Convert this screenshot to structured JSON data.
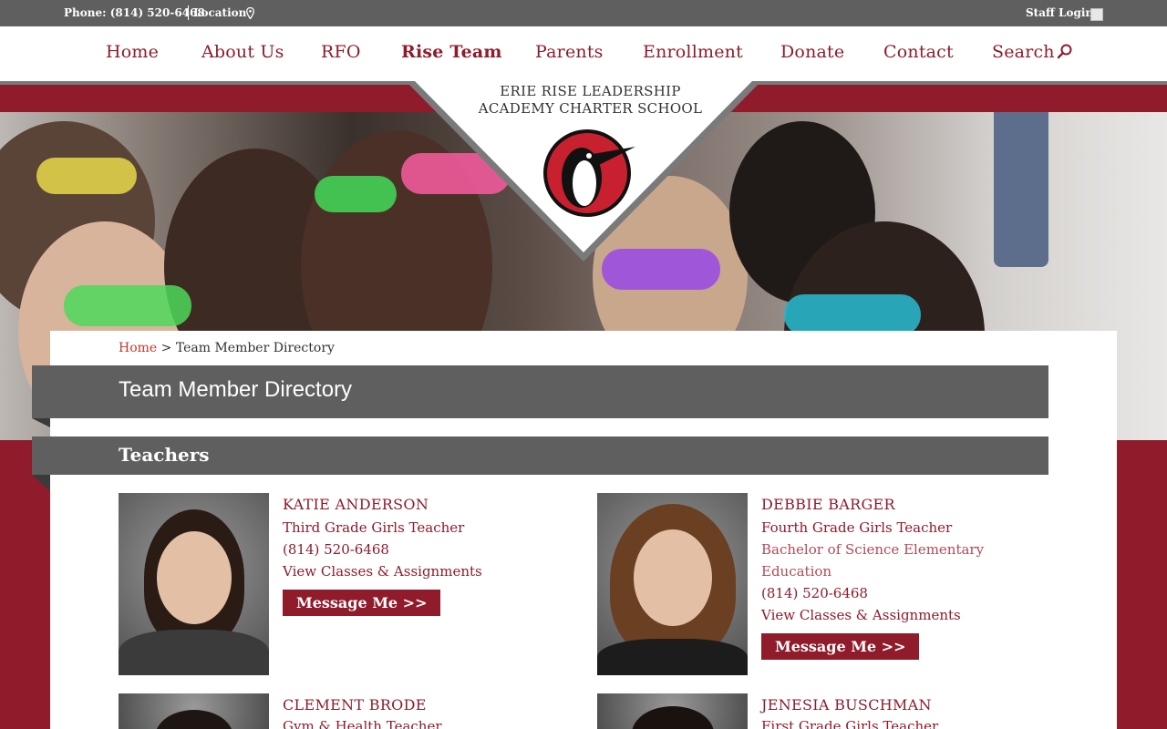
{
  "topbar": {
    "phone": "Phone: (814) 520-6468",
    "location": "Location",
    "staff_login": "Staff Login"
  },
  "nav": {
    "items": [
      "Home",
      "About Us",
      "RFO",
      "Rise Team",
      "Parents",
      "Enrollment",
      "Donate",
      "Contact",
      "Search"
    ],
    "active": "Rise Team"
  },
  "logo": {
    "line1": "ERIE RISE LEADERSHIP",
    "line2": "ACADEMY CHARTER SCHOOL"
  },
  "breadcrumb": {
    "home": "Home",
    "separator": ">",
    "current": "Team Member Directory"
  },
  "page_title": "Team Member Directory",
  "section_title": "Teachers",
  "teachers": [
    {
      "name": "KATIE ANDERSON",
      "role": "Third Grade Girls Teacher",
      "phone": "(814) 520-6468",
      "classes_link": "View Classes & Assignments",
      "button": "Message Me >>"
    },
    {
      "name": "DEBBIE BARGER",
      "role": "Fourth Grade Girls Teacher",
      "degree_line1": "Bachelor of Science Elementary",
      "degree_line2": "Education",
      "phone": "(814) 520-6468",
      "classes_link": "View Classes & Assignments",
      "button": "Message Me >>"
    },
    {
      "name": "CLEMENT BRODE",
      "role": "Gym & Health Teacher"
    },
    {
      "name": "JENESIA BUSCHMAN",
      "role": "First Grade Girls Teacher"
    }
  ],
  "colors": {
    "brand_red": "#8f1b2b",
    "bar_gray": "#5f5f5f"
  }
}
